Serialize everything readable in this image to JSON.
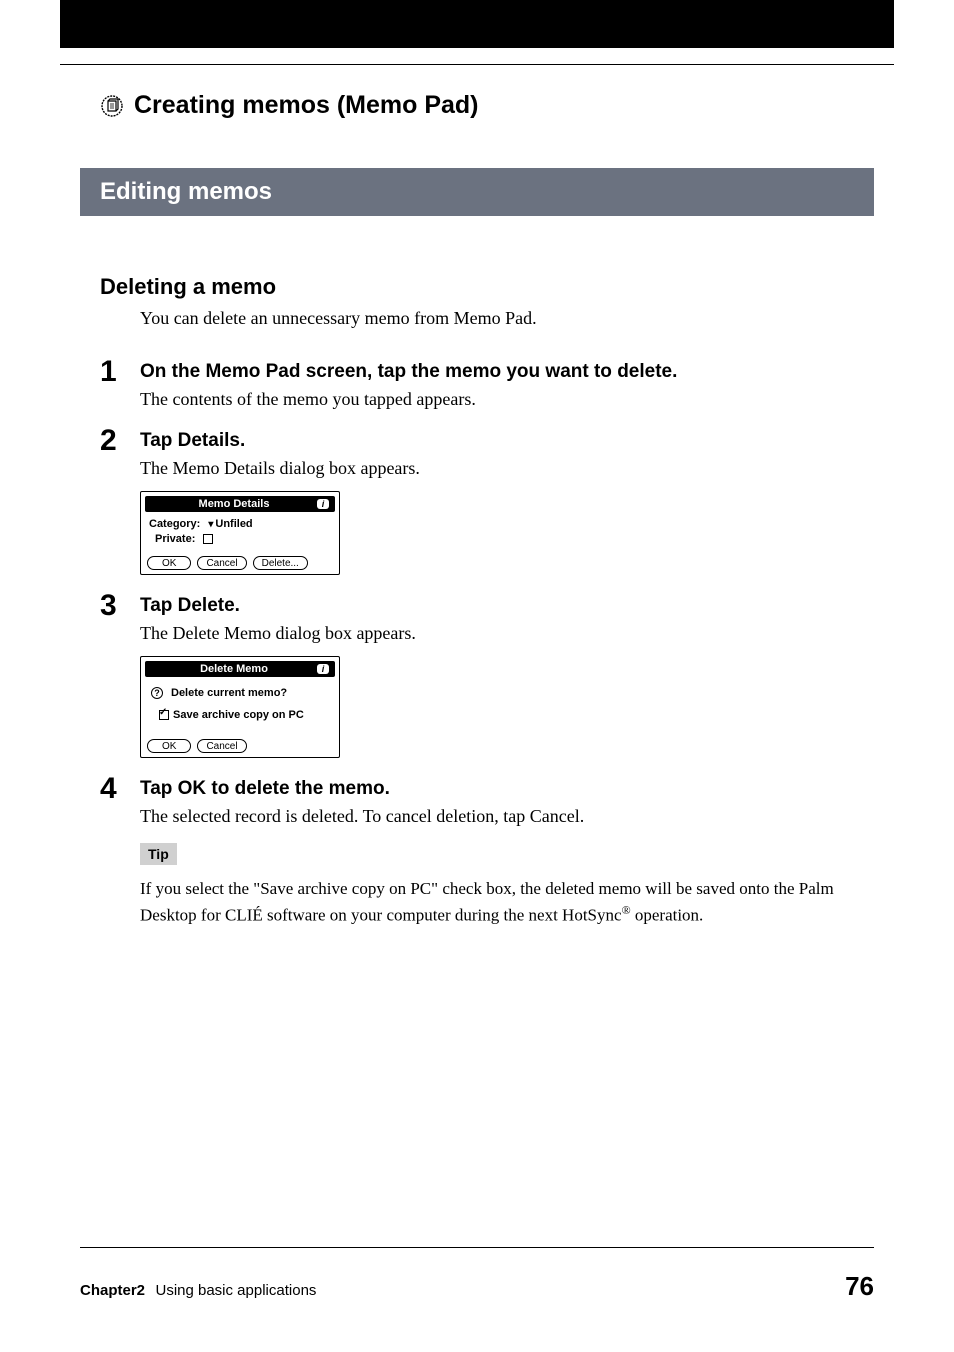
{
  "header": {
    "chapter_title": "Creating memos (Memo Pad)"
  },
  "section": {
    "title": "Editing memos"
  },
  "subsection": {
    "title": "Deleting a memo",
    "intro": "You can delete an unnecessary memo from Memo Pad."
  },
  "steps": [
    {
      "num": "1",
      "heading": "On the Memo Pad screen, tap the memo you want to delete.",
      "body": "The contents of the memo you tapped appears."
    },
    {
      "num": "2",
      "heading": "Tap Details.",
      "body": "The Memo Details dialog box appears."
    },
    {
      "num": "3",
      "heading": "Tap Delete.",
      "body": "The Delete Memo dialog box appears."
    },
    {
      "num": "4",
      "heading": "Tap OK to delete the memo.",
      "body": "The selected record is deleted. To cancel deletion, tap Cancel."
    }
  ],
  "dialog1": {
    "title": "Memo Details",
    "category_label": "Category:",
    "category_value": "Unfiled",
    "private_label": "Private:",
    "ok": "OK",
    "cancel": "Cancel",
    "delete": "Delete..."
  },
  "dialog2": {
    "title": "Delete Memo",
    "question": "Delete current memo?",
    "archive": "Save archive copy on PC",
    "ok": "OK",
    "cancel": "Cancel"
  },
  "tip": {
    "label": "Tip",
    "body_before": "If you select the \"Save archive copy on PC\" check box, the deleted memo will be saved onto the Palm Desktop for CLIÉ software on your computer during the next HotSync",
    "body_sup": "®",
    "body_after": " operation."
  },
  "footer": {
    "chapter": "Chapter2",
    "subtitle": "Using basic applications",
    "page": "76"
  }
}
